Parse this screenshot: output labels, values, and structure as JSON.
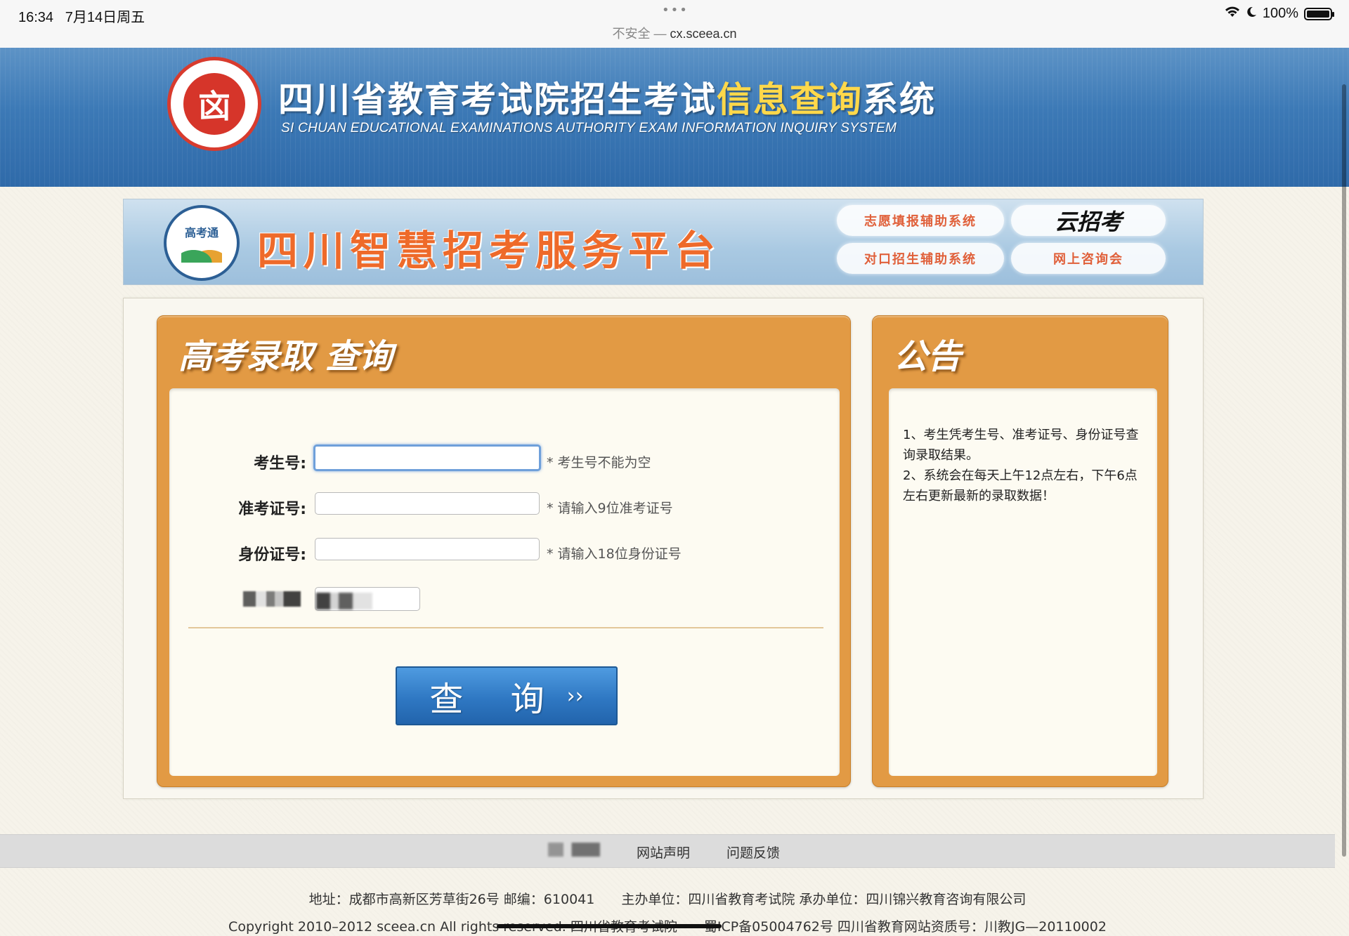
{
  "status_bar": {
    "time": "16:34",
    "date": "7月14日周五",
    "insecure": "不安全",
    "dash": " — ",
    "url": "cx.sceea.cn",
    "battery_text": "100%",
    "battery_level": 1.0
  },
  "header": {
    "seal_glyph": "㐫",
    "title_main": "四川省教育考试院招生考试",
    "title_highlight": "信息查询",
    "title_tail": "系统",
    "subtitle": "SI CHUAN EDUCATIONAL EXAMINATIONS AUTHORITY EXAM INFORMATION INQUIRY SYSTEM"
  },
  "promo": {
    "logo_text": "高考通",
    "title": "四川智慧招考服务平台",
    "btn_volunteer": "志愿填报辅助系统",
    "btn_cloud": "云招考",
    "btn_duikou": "对口招生辅助系统",
    "btn_consult": "网上咨询会"
  },
  "query_panel": {
    "title": "高考录取 查询",
    "fields": [
      {
        "label": "考生号:",
        "hint": "* 考生号不能为空",
        "value": ""
      },
      {
        "label": "准考证号:",
        "hint": "* 请输入9位准考证号",
        "value": ""
      },
      {
        "label": "身份证号:",
        "hint": "* 请输入18位身份证号",
        "value": ""
      }
    ],
    "submit_label": "查 询",
    "submit_arrow": "››"
  },
  "notice_panel": {
    "title": "公告",
    "items": [
      "1、考生凭考生号、准考证号、身份证号查询录取结果。",
      "2、系统会在每天上午12点左右，下午6点左右更新最新的录取数据！"
    ]
  },
  "footer": {
    "link_statement": "网站声明",
    "link_feedback": "问题反馈",
    "line1": "地址：成都市高新区芳草街26号 邮编：610041　　主办单位：四川省教育考试院 承办单位：四川锦兴教育咨询有限公司",
    "line2": "Copyright 2010–2012 sceea.cn All rights reserved. 四川省教育考试院　　蜀ICP备05004762号 四川省教育网站资质号：川教JG—20110002"
  },
  "colors": {
    "header_blue": "#3c79b6",
    "panel_orange": "#e29a44",
    "button_blue": "#2f78c3",
    "title_highlight": "#ffd84a",
    "promo_orange": "#ee6a2a"
  }
}
